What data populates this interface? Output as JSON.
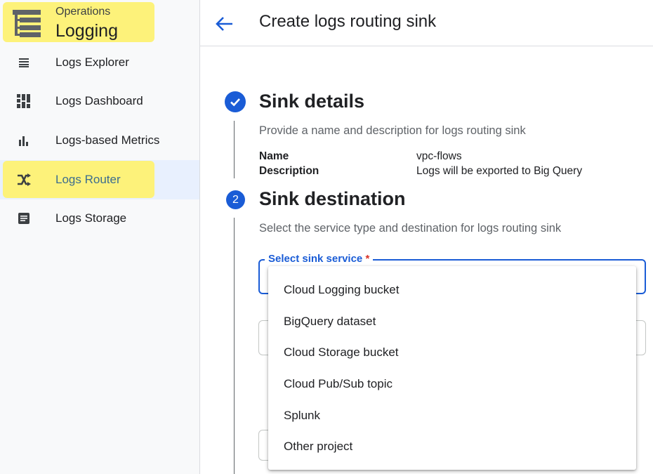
{
  "sidebar": {
    "brand": {
      "subtitle": "Operations",
      "title": "Logging"
    },
    "items": [
      {
        "label": "Logs Explorer",
        "icon": "list-icon",
        "active": false
      },
      {
        "label": "Logs Dashboard",
        "icon": "dashboard-icon",
        "active": false
      },
      {
        "label": "Logs-based Metrics",
        "icon": "bar-chart-icon",
        "active": false
      },
      {
        "label": "Logs Router",
        "icon": "router-shuffle-icon",
        "active": true
      },
      {
        "label": "Logs Storage",
        "icon": "storage-icon",
        "active": false
      }
    ],
    "highlight_color": "#fdf27a",
    "active_bg_color": "#e8f0fe"
  },
  "header": {
    "title": "Create logs routing sink",
    "back_icon": "arrow-back-icon"
  },
  "steps": [
    {
      "badge": "",
      "status": "complete",
      "title": "Sink details",
      "description": "Provide a name and description for logs routing sink",
      "fields": [
        {
          "key": "Name",
          "value": "vpc-flows"
        },
        {
          "key": "Description",
          "value": "Logs will be exported to Big Query"
        }
      ]
    },
    {
      "badge": "2",
      "status": "active",
      "title": "Sink destination",
      "description": "Select the service type and destination for logs routing sink"
    }
  ],
  "select": {
    "label": "Select sink service",
    "required_mark": "*",
    "options": [
      "Cloud Logging bucket",
      "BigQuery dataset",
      "Cloud Storage bucket",
      "Cloud Pub/Sub topic",
      "Splunk",
      "Other project"
    ]
  },
  "colors": {
    "accent": "#1a5cd6",
    "required": "#d93025"
  }
}
